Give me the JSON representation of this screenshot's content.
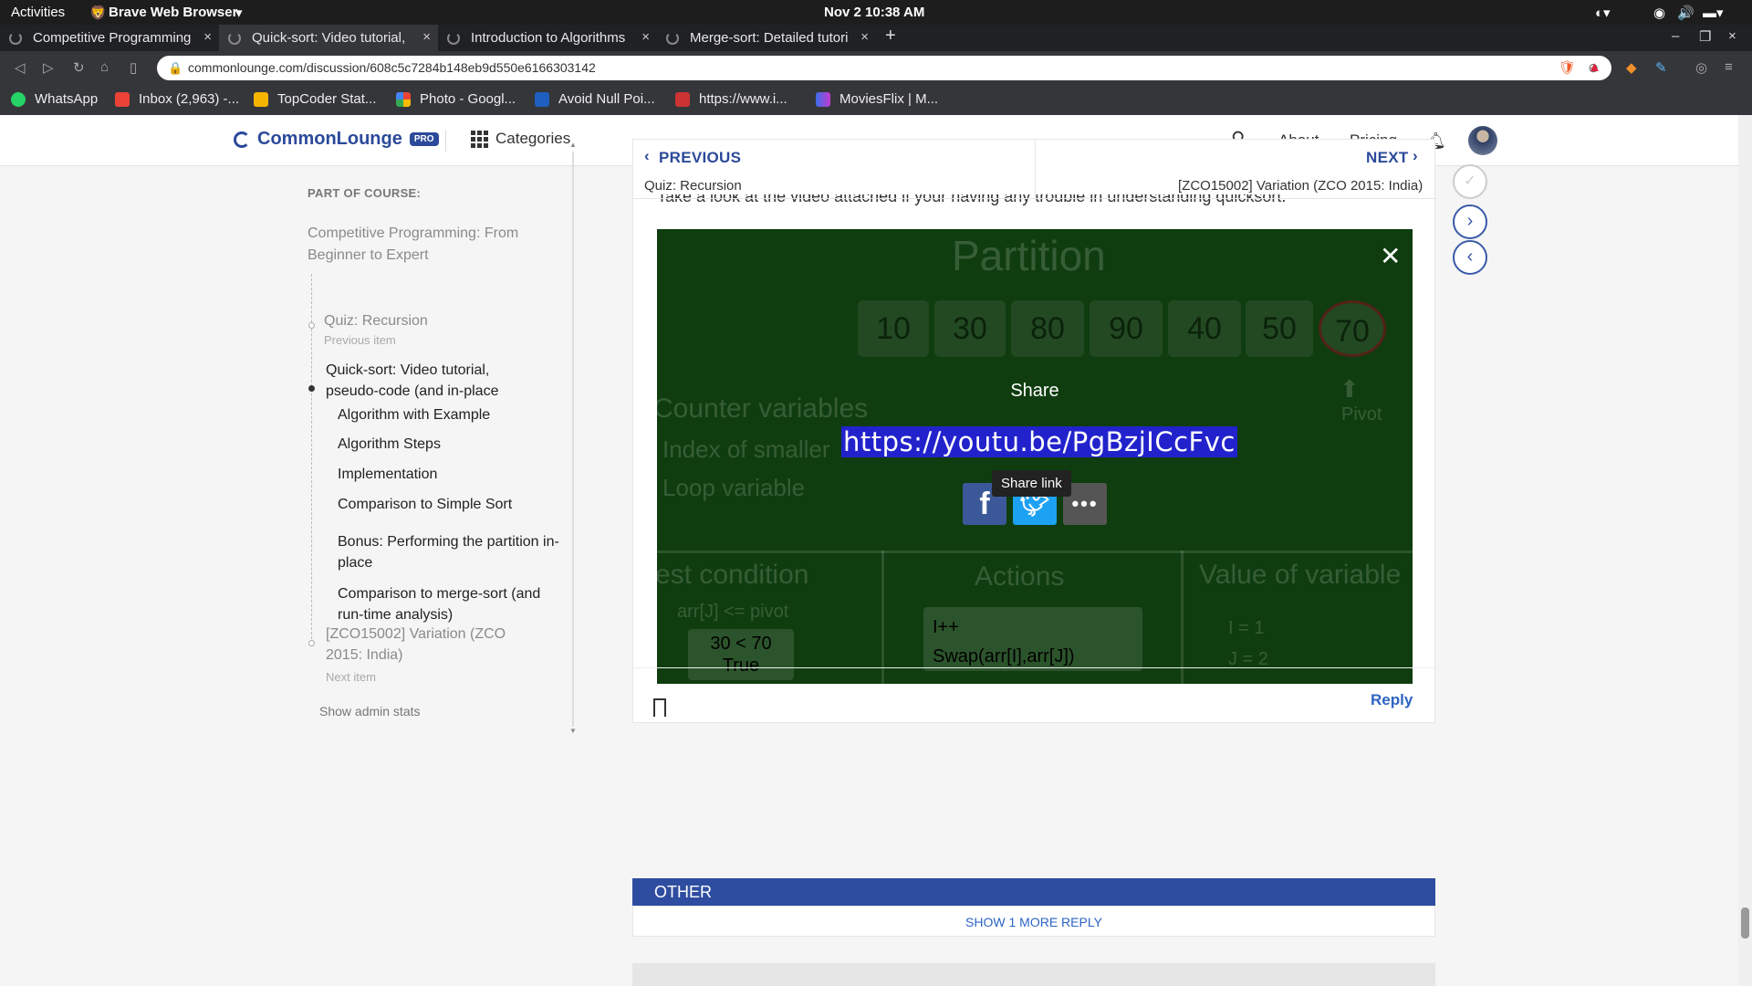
{
  "system_bar": {
    "activities": "Activities",
    "app_name": "Brave Web Browser",
    "clock": "Nov 2  10:38 AM"
  },
  "tabs": [
    {
      "title": "Competitive Programming"
    },
    {
      "title": "Quick-sort: Video tutorial,"
    },
    {
      "title": "Introduction to Algorithms"
    },
    {
      "title": "Merge-sort: Detailed tutori"
    }
  ],
  "address": {
    "url": "commonlounge.com/discussion/608c5c7284b148eb9d550e6166303142"
  },
  "bookmarks": [
    {
      "label": "WhatsApp"
    },
    {
      "label": "Inbox (2,963) -..."
    },
    {
      "label": "TopCoder Stat..."
    },
    {
      "label": "Photo - Googl..."
    },
    {
      "label": "Avoid Null Poi..."
    },
    {
      "label": "https://www.i..."
    },
    {
      "label": "MoviesFlix | M..."
    }
  ],
  "site_header": {
    "logo": "CommonLounge",
    "badge": "PRO",
    "categories": "Categories",
    "about": "About",
    "pricing": "Pricing"
  },
  "sidebar": {
    "heading": "PART OF COURSE:",
    "course": "Competitive Programming: From Beginner to Expert",
    "prev_item": "Quiz: Recursion",
    "prev_label": "Previous item",
    "current_item": "Quick-sort: Video tutorial, pseudo-code (and in-place",
    "sections": [
      "Algorithm with Example",
      "Algorithm Steps",
      "Implementation",
      "Comparison to Simple Sort",
      "Bonus: Performing the partition in-place",
      "Comparison to merge-sort (and run-time analysis)"
    ],
    "next_item": "[ZCO15002] Variation (ZCO 2015: India)",
    "next_label": "Next item",
    "admin": "Show admin stats"
  },
  "nav": {
    "previous_label": "PREVIOUS",
    "previous_title": "Quiz: Recursion",
    "next_label": "NEXT",
    "next_title": "[ZCO15002] Variation (ZCO 2015: India)"
  },
  "content": {
    "intro_text": "Take a look at the video attached if your having any trouble in understanding quicksort."
  },
  "video": {
    "title": "Partition",
    "cells": [
      "10",
      "30",
      "80",
      "90",
      "40",
      "50",
      "70"
    ],
    "pivot_label": "Pivot",
    "counter_label": "Counter variables",
    "index_label": "Index of smaller",
    "loop_label": "Loop variable",
    "test_header": "est condition",
    "actions_header": "Actions",
    "value_header": "Value of variable",
    "cond_expr": "arr[J] <= pivot",
    "cond_box": "30 < 70",
    "cond_result": "True",
    "action_1": "I++",
    "action_2": "Swap(arr[I],arr[J])",
    "val_i": "I = 1",
    "val_j": "J = 2",
    "share_title": "Share",
    "share_url": "https://youtu.be/PgBzjICcFvc",
    "tooltip": "Share link"
  },
  "actions": {
    "reply": "Reply"
  },
  "other": {
    "heading": "OTHER",
    "more_replies": "SHOW 1 MORE REPLY"
  }
}
